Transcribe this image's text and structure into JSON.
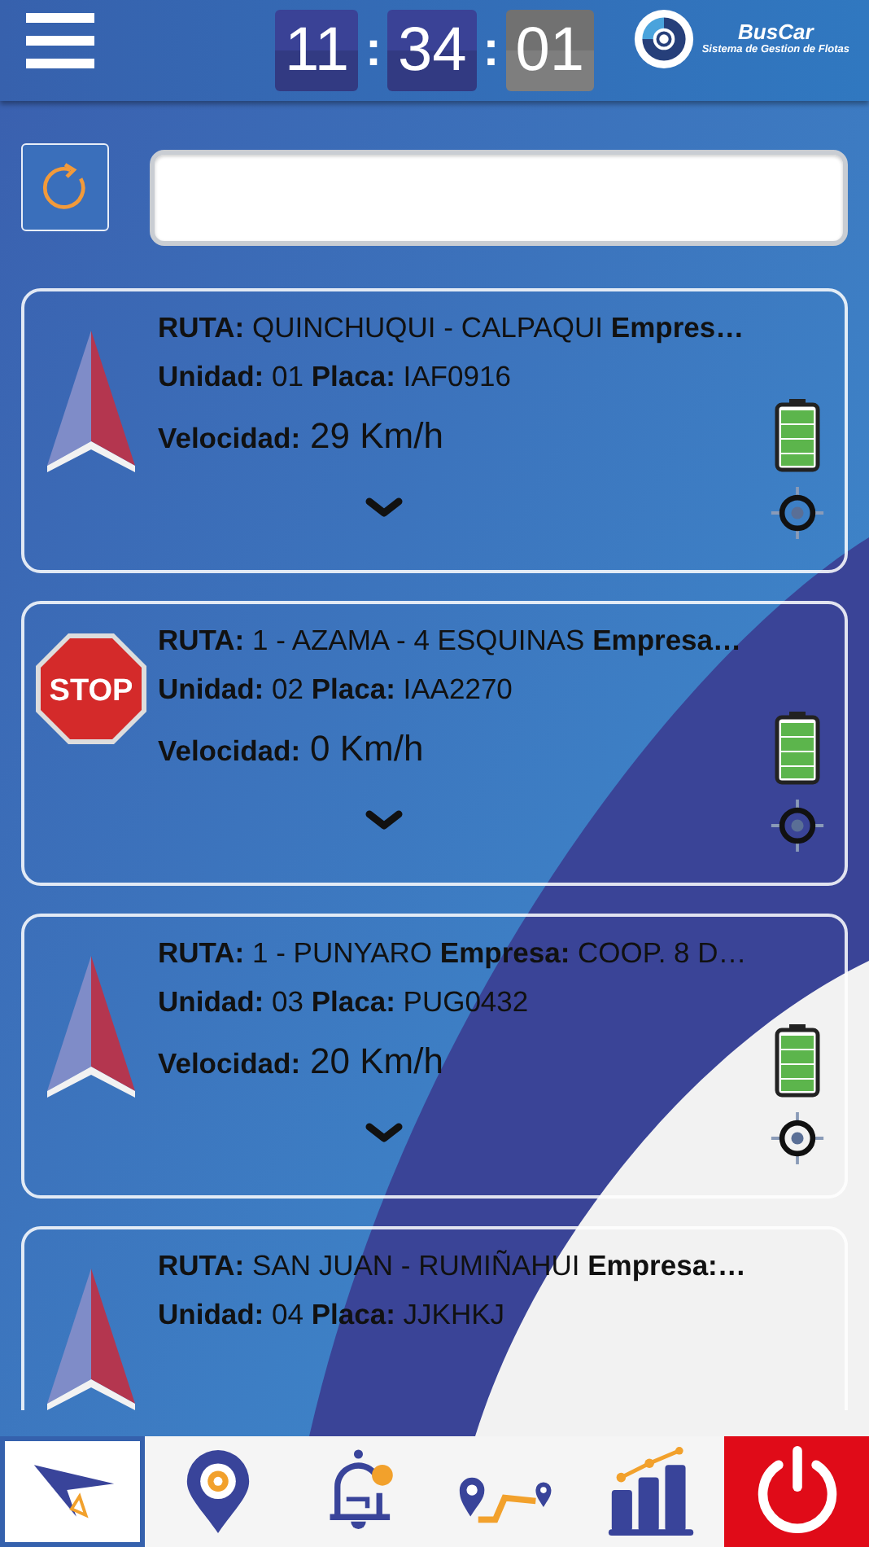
{
  "header": {
    "clock": [
      {
        "text": "11",
        "kind": "unit"
      },
      {
        "text": ":",
        "kind": "sep"
      },
      {
        "text": "34",
        "kind": "unit"
      },
      {
        "text": ":",
        "kind": "sep"
      },
      {
        "text": "01",
        "kind": "seconds"
      }
    ],
    "logo": {
      "name": "BusCar",
      "tagline": "Sistema de Gestion de Flotas"
    }
  },
  "vehicles": [
    {
      "kind": "moving",
      "route": "**RUTA:** QUINCHUQUI - CALPAQUI **Empres…**",
      "unit": "**Unidad:** 01 **Placa:** IAF0916",
      "speed_label": "Velocidad:",
      "speed": "29 Km/h"
    },
    {
      "kind": "stopped",
      "sign": "STOP",
      "route": "**RUTA:** 1 - AZAMA - 4 ESQUINAS **Empresa…**",
      "unit": "**Unidad:** 02 **Placa:** IAA2270",
      "speed_label": "Velocidad:",
      "speed": "0 Km/h"
    },
    {
      "kind": "moving",
      "route": "**RUTA:** 1 - PUNYARO **Empresa:** COOP. 8 D…",
      "unit": "**Unidad:** 03 **Placa:** PUG0432",
      "speed_label": "Velocidad:",
      "speed": "20 Km/h"
    },
    {
      "kind": "moving",
      "route": "**RUTA:** SAN JUAN - RUMIÑAHUI **Empresa:…**",
      "unit": "**Unidad:** 04 **Placa:** JJKHKJ"
    }
  ],
  "nav": [
    {
      "kind": "plane",
      "selected": true
    },
    {
      "kind": "pin",
      "selected": false
    },
    {
      "kind": "bell",
      "selected": false
    },
    {
      "kind": "route",
      "selected": false
    },
    {
      "kind": "chart",
      "selected": false
    },
    {
      "kind": "power",
      "selected": false
    }
  ]
}
